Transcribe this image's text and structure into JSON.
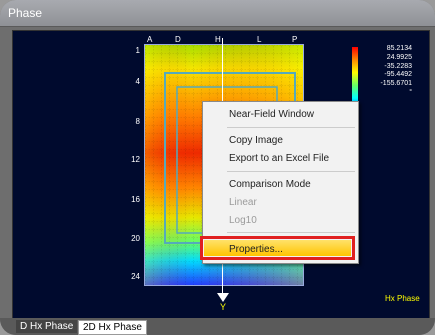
{
  "window": {
    "title": "Phase"
  },
  "heatmap": {
    "columns": [
      "A",
      "D",
      "H",
      "L",
      "P"
    ],
    "rows": [
      "1",
      "4",
      "8",
      "12",
      "16",
      "20",
      "24"
    ],
    "legend_values": [
      "85.2134",
      "24.9925",
      "-35.2283",
      "-95.4492",
      "-155.6701",
      "°"
    ],
    "plot_label": "Hx Phase",
    "axis_label": "Y"
  },
  "context_menu": {
    "items": [
      {
        "label": "Near-Field Window",
        "enabled": true
      },
      {
        "label": "Copy Image",
        "enabled": true
      },
      {
        "label": "Export to an Excel File",
        "enabled": true
      },
      {
        "label": "Comparison Mode",
        "enabled": true
      },
      {
        "label": "Linear",
        "enabled": false
      },
      {
        "label": "Log10",
        "enabled": false
      },
      {
        "label": "Properties...",
        "enabled": true,
        "highlighted": true
      }
    ]
  },
  "tabs": [
    {
      "label": "D Hx Phase",
      "active": false
    },
    {
      "label": "2D Hx Phase",
      "active": true
    }
  ]
}
